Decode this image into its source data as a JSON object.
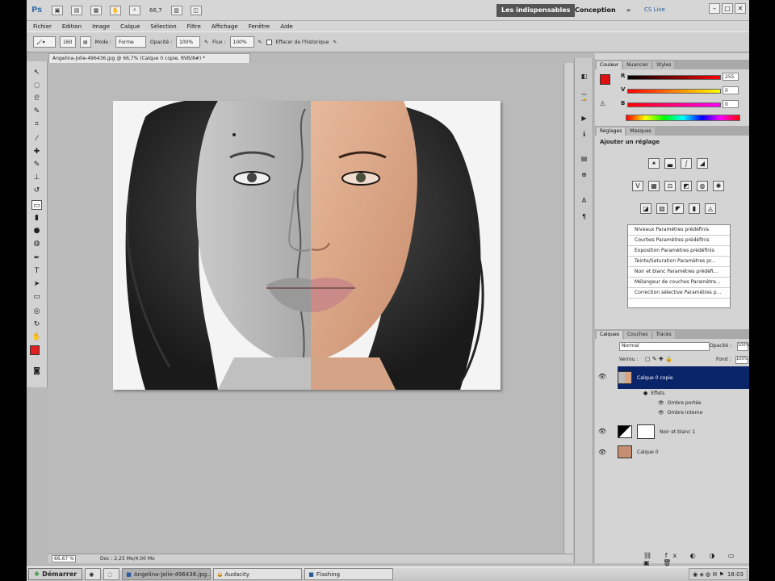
{
  "appbar": {
    "logo": "Ps",
    "zoom": "66,7",
    "workspaces": [
      "Les indispensables",
      "Conception",
      "»"
    ],
    "cs_live": "CS Live"
  },
  "menu": [
    "Fichier",
    "Edition",
    "Image",
    "Calque",
    "Sélection",
    "Filtre",
    "Affichage",
    "Fenêtre",
    "Aide"
  ],
  "options": {
    "brush_size": "160",
    "mode_label": "Mode :",
    "mode_value": "Forme",
    "opacity_label": "Opacité :",
    "opacity_value": "100%",
    "flow_label": "Flux :",
    "flow_value": "100%",
    "history_label": "Effacer de l'historique"
  },
  "document": {
    "tab_title": "Angelina-Jolie-496436.jpg @ 66,7% (Calque 0 copie, RVB/8#) *",
    "zoom": "66,67 %",
    "status": "Doc : 2,25 Mo/4,00 Mo"
  },
  "color_panel": {
    "tabs": [
      "Couleur",
      "Nuancier",
      "Styles"
    ],
    "channels": [
      {
        "label": "R",
        "value": "255",
        "color": "#ff0000"
      },
      {
        "label": "V",
        "value": "0",
        "color": "#00ff00"
      },
      {
        "label": "B",
        "value": "0",
        "color": "#0000ff"
      }
    ],
    "foreground": "#e01010"
  },
  "adjust_panel": {
    "tabs": [
      "Réglages",
      "Masques"
    ],
    "title": "Ajouter un réglage",
    "presets": [
      "Niveaux Paramètres prédéfinis",
      "Courbes Paramètres prédéfinis",
      "Exposition Paramètres prédéfinis",
      "Teinte/Saturation Paramètres pr...",
      "Noir et blanc Paramètres prédéfi...",
      "Mélangeur de couches Paramètre...",
      "Correction sélective Paramètres p..."
    ]
  },
  "layers_panel": {
    "tabs": [
      "Calques",
      "Couches",
      "Tracés"
    ],
    "blend_mode": "Normal",
    "opacity_label": "Opacité :",
    "opacity_value": "100%",
    "lock_label": "Verrou :",
    "fill_label": "Fond :",
    "fill_value": "100%",
    "layers": [
      {
        "name": "Calque 0 copie",
        "selected": true
      },
      {
        "name": "Effets",
        "sub": true
      },
      {
        "name": "Ombre portée",
        "effect": true
      },
      {
        "name": "Ombre interne",
        "effect": true
      },
      {
        "name": "Noir et blanc 1",
        "adjust": true
      },
      {
        "name": "Calque 0"
      }
    ]
  },
  "taskbar": {
    "start": "Démarrer",
    "tasks": [
      "Angelina-Jolie-496436.jpg...",
      "Audacity",
      "Flashing"
    ],
    "clock": "18:03"
  }
}
